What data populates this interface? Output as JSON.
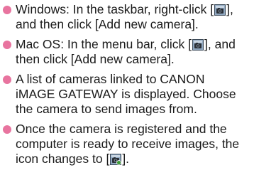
{
  "colors": {
    "bullet": "#e8749f",
    "text": "#1a1a1a",
    "icon_panel": "#8fa7c0",
    "icon_frame": "#3c4a58",
    "icon_camera": "#2a2f36",
    "icon_badge": "#3f9b3a"
  },
  "icons": {
    "camera_connect": "camera-connect-icon",
    "camera_ready": "camera-ready-icon"
  },
  "items": [
    {
      "line1_before": "Windows: In the taskbar, right-click [",
      "line1_after": "],",
      "line2": "and then click [Add new camera]."
    },
    {
      "line1_before": "Mac OS: In the menu bar, click [",
      "line1_after": "], and",
      "line2": "then click [Add new camera]."
    },
    {
      "line1": "A list of cameras linked to CANON",
      "line2": "iMAGE GATEWAY is displayed. Choose",
      "line3": "the camera to send images from."
    },
    {
      "line1": "Once the camera is registered and the",
      "line2": "computer is ready to receive images, the",
      "line3_before": "icon changes to [",
      "line3_after": "]."
    }
  ]
}
